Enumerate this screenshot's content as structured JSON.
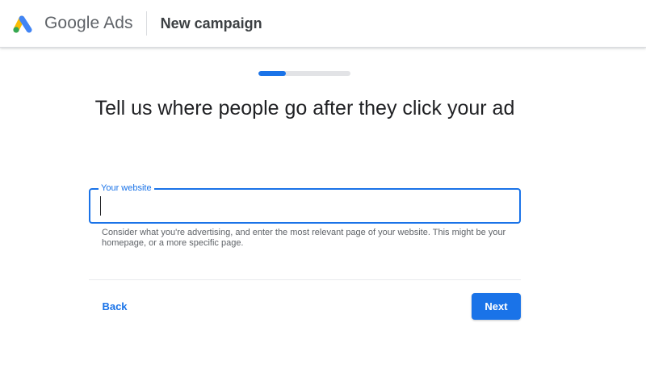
{
  "header": {
    "product_name": "Google Ads",
    "page_title": "New campaign",
    "logo_icon": "google-ads-logo-icon"
  },
  "progress": {
    "fraction": 0.3
  },
  "main": {
    "headline": "Tell us where people go after they click your ad",
    "website_field": {
      "label": "Your website",
      "value": "",
      "placeholder": ""
    },
    "helper_text": "Consider what you're advertising, and enter the most relevant page of your website. This might be your homepage, or a more specific page."
  },
  "footer": {
    "back_label": "Back",
    "next_label": "Next"
  },
  "colors": {
    "accent": "#1a73e8",
    "logo_blue": "#4285f4",
    "logo_yellow": "#fbbc04",
    "logo_green": "#34a853"
  }
}
